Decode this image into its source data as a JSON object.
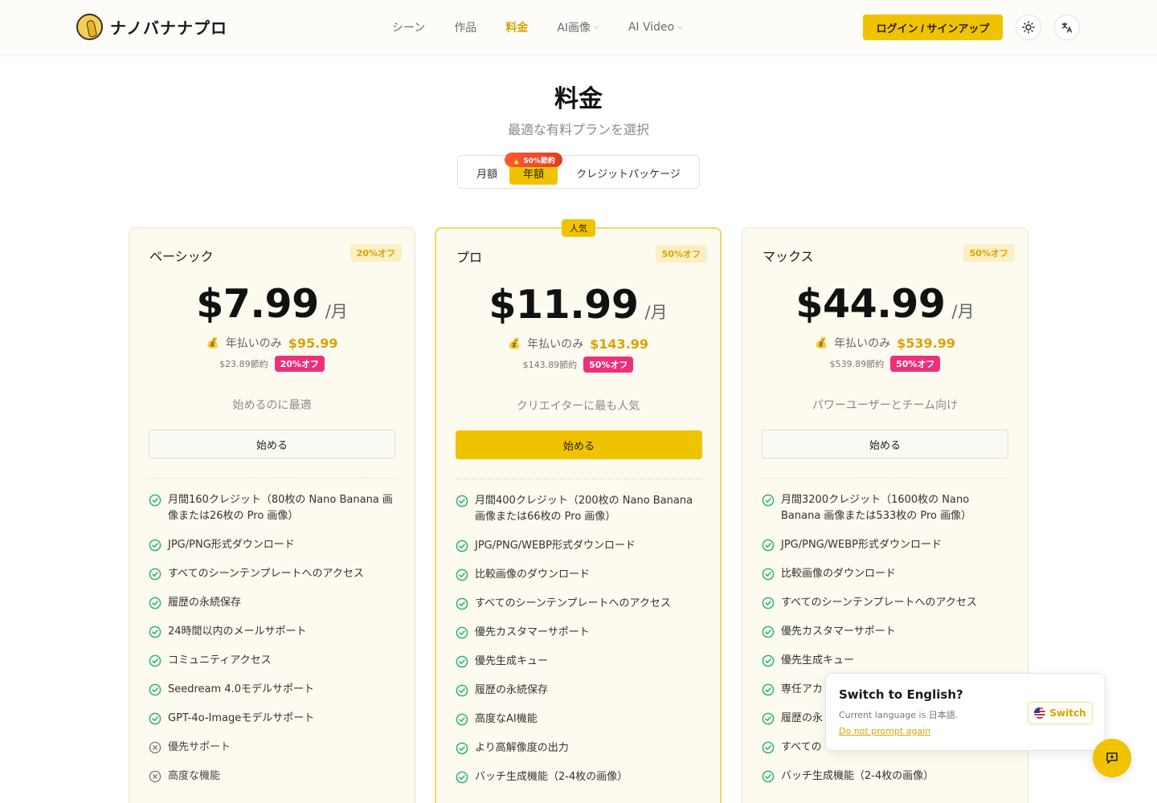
{
  "brand": {
    "name": "ナノバナナプロ"
  },
  "nav": [
    {
      "label": "シーン",
      "active": false,
      "dropdown": false
    },
    {
      "label": "作品",
      "active": false,
      "dropdown": false
    },
    {
      "label": "料金",
      "active": true,
      "dropdown": false
    },
    {
      "label": "AI画像",
      "active": false,
      "dropdown": true
    },
    {
      "label": "AI Video",
      "active": false,
      "dropdown": true
    }
  ],
  "header": {
    "login_label": "ログイン / サインアップ",
    "theme_icon": "sun-icon",
    "lang_icon": "translate-icon"
  },
  "page": {
    "title": "料金",
    "subtitle": "最適な有料プランを選択"
  },
  "billing_toggle": {
    "monthly": "月額",
    "yearly": "年額",
    "credits": "クレジットパッケージ",
    "save_badge": "🔥 50%節約",
    "selected": "yearly"
  },
  "popular_tag": "人気",
  "plans": [
    {
      "name": "ベーシック",
      "off_chip": "20%オフ",
      "price": "$7.99",
      "per": "/月",
      "annual_label": "年払いのみ",
      "annual_price": "$95.99",
      "saved": "$23.89節約",
      "saved_chip": "20%オフ",
      "tagline": "始めるのに最適",
      "cta": "始める",
      "features": [
        {
          "text": "月間160クレジット（80枚の Nano Banana 画像または26枚の Pro 画像）",
          "included": true
        },
        {
          "text": "JPG/PNG形式ダウンロード",
          "included": true
        },
        {
          "text": "すべてのシーンテンプレートへのアクセス",
          "included": true
        },
        {
          "text": "履歴の永続保存",
          "included": true
        },
        {
          "text": "24時間以内のメールサポート",
          "included": true
        },
        {
          "text": "コミュニティアクセス",
          "included": true
        },
        {
          "text": "Seedream 4.0モデルサポート",
          "included": true
        },
        {
          "text": "GPT-4o-Imageモデルサポート",
          "included": true
        },
        {
          "text": "優先サポート",
          "included": false
        },
        {
          "text": "高度な機能",
          "included": false
        }
      ]
    },
    {
      "name": "プロ",
      "off_chip": "50%オフ",
      "price": "$11.99",
      "per": "/月",
      "annual_label": "年払いのみ",
      "annual_price": "$143.99",
      "saved": "$143.89節約",
      "saved_chip": "50%オフ",
      "tagline": "クリエイターに最も人気",
      "cta": "始める",
      "features": [
        {
          "text": "月間400クレジット（200枚の Nano Banana 画像または66枚の Pro 画像）",
          "included": true
        },
        {
          "text": "JPG/PNG/WEBP形式ダウンロード",
          "included": true
        },
        {
          "text": "比較画像のダウンロード",
          "included": true
        },
        {
          "text": "すべてのシーンテンプレートへのアクセス",
          "included": true
        },
        {
          "text": "優先カスタマーサポート",
          "included": true
        },
        {
          "text": "優先生成キュー",
          "included": true
        },
        {
          "text": "履歴の永続保存",
          "included": true
        },
        {
          "text": "高度なAI機能",
          "included": true
        },
        {
          "text": "より高解像度の出力",
          "included": true
        },
        {
          "text": "バッチ生成機能（2-4枚の画像）",
          "included": true
        }
      ]
    },
    {
      "name": "マックス",
      "off_chip": "50%オフ",
      "price": "$44.99",
      "per": "/月",
      "annual_label": "年払いのみ",
      "annual_price": "$539.99",
      "saved": "$539.89節約",
      "saved_chip": "50%オフ",
      "tagline": "パワーユーザーとチーム向け",
      "cta": "始める",
      "features": [
        {
          "text": "月間3200クレジット（1600枚の Nano Banana 画像または533枚の Pro 画像）",
          "included": true
        },
        {
          "text": "JPG/PNG/WEBP形式ダウンロード",
          "included": true
        },
        {
          "text": "比較画像のダウンロード",
          "included": true
        },
        {
          "text": "すべてのシーンテンプレートへのアクセス",
          "included": true
        },
        {
          "text": "優先カスタマーサポート",
          "included": true
        },
        {
          "text": "優先生成キュー",
          "included": true
        },
        {
          "text": "専任アカ",
          "included": true
        },
        {
          "text": "履歴の永",
          "included": true
        },
        {
          "text": "すべての",
          "included": true
        },
        {
          "text": "バッチ生成機能（2-4枚の画像）",
          "included": true
        }
      ]
    }
  ],
  "lang_popup": {
    "title": "Switch to English?",
    "current": "Current language is 日本語.",
    "dont_prompt": "Do not prompt again",
    "switch_label": "Switch"
  },
  "colors": {
    "accent": "#f0c300",
    "accent_text": "#d9a400",
    "pink": "#ee2f7a",
    "check": "#2bb673"
  }
}
